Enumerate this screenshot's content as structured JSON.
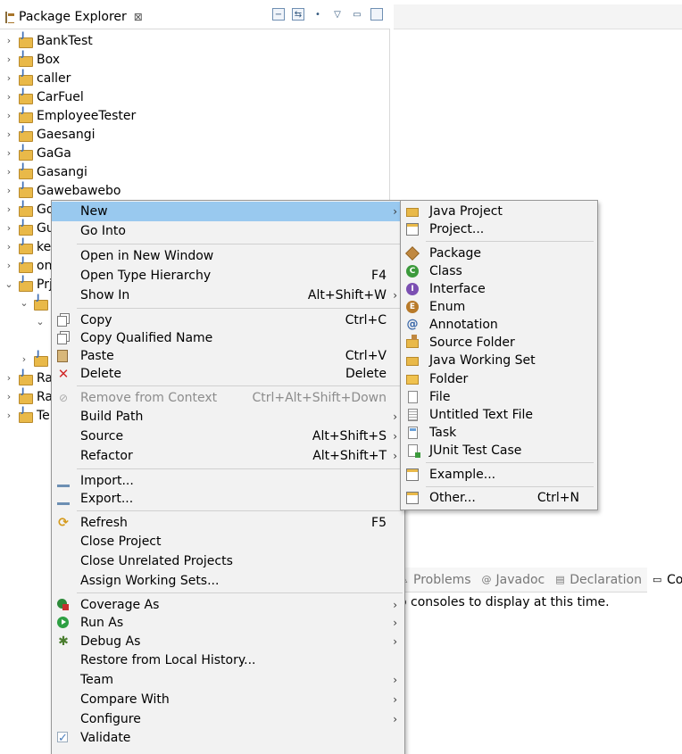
{
  "package_explorer": {
    "title": "Package Explorer",
    "close_glyph": "⊠",
    "projects": [
      {
        "label": "BankTest",
        "twisty": "›"
      },
      {
        "label": "Box",
        "twisty": "›"
      },
      {
        "label": "caller",
        "twisty": "›"
      },
      {
        "label": "CarFuel",
        "twisty": "›"
      },
      {
        "label": "EmployeeTester",
        "twisty": "›"
      },
      {
        "label": "Gaesangi",
        "twisty": "›"
      },
      {
        "label": "GaGa",
        "twisty": "›"
      },
      {
        "label": "Gasangi",
        "twisty": "›"
      },
      {
        "label": "Gawebawebo",
        "twisty": "›"
      },
      {
        "label": "Go",
        "twisty": "›"
      },
      {
        "label": "Gu",
        "twisty": "›"
      },
      {
        "label": "ke",
        "twisty": "›"
      },
      {
        "label": "on",
        "twisty": "›"
      },
      {
        "label": "Prj",
        "twisty": "⌄"
      },
      {
        "label": "",
        "twisty": "⌄"
      },
      {
        "label": "",
        "twisty": "⌄"
      },
      {
        "label": "",
        "twisty": "›"
      },
      {
        "label": "Ra",
        "twisty": "›"
      },
      {
        "label": "Ra",
        "twisty": "›"
      },
      {
        "label": "Te",
        "twisty": "›"
      }
    ]
  },
  "bottom_panel": {
    "tabs": [
      {
        "label": "Problems",
        "icon": "problems-icon"
      },
      {
        "label": "Javadoc",
        "icon": "javadoc-icon"
      },
      {
        "label": "Declaration",
        "icon": "declaration-icon"
      },
      {
        "label": "Conso",
        "icon": "console-icon"
      }
    ],
    "message": "o consoles to display at this time."
  },
  "context_menu": {
    "items": [
      {
        "label": "New",
        "accel": "",
        "arrow": "›",
        "icon": "",
        "selected": true
      },
      {
        "label": "Go Into",
        "accel": "",
        "arrow": "",
        "icon": ""
      },
      {
        "label": "Open in New Window",
        "accel": "",
        "arrow": "",
        "icon": ""
      },
      {
        "label": "Open Type Hierarchy",
        "accel": "F4",
        "arrow": "",
        "icon": ""
      },
      {
        "label": "Show In",
        "accel": "Alt+Shift+W",
        "arrow": "›",
        "icon": ""
      },
      {
        "label": "Copy",
        "accel": "Ctrl+C",
        "arrow": "",
        "icon": "copy-icon"
      },
      {
        "label": "Copy Qualified Name",
        "accel": "",
        "arrow": "",
        "icon": "copy-qualified-icon"
      },
      {
        "label": "Paste",
        "accel": "Ctrl+V",
        "arrow": "",
        "icon": "paste-icon"
      },
      {
        "label": "Delete",
        "accel": "Delete",
        "arrow": "",
        "icon": "delete-icon"
      },
      {
        "label": "Remove from Context",
        "accel": "Ctrl+Alt+Shift+Down",
        "arrow": "",
        "icon": "remove-context-icon",
        "disabled": true
      },
      {
        "label": "Build Path",
        "accel": "",
        "arrow": "›",
        "icon": ""
      },
      {
        "label": "Source",
        "accel": "Alt+Shift+S",
        "arrow": "›",
        "icon": ""
      },
      {
        "label": "Refactor",
        "accel": "Alt+Shift+T",
        "arrow": "›",
        "icon": ""
      },
      {
        "label": "Import...",
        "accel": "",
        "arrow": "",
        "icon": "import-icon"
      },
      {
        "label": "Export...",
        "accel": "",
        "arrow": "",
        "icon": "export-icon"
      },
      {
        "label": "Refresh",
        "accel": "F5",
        "arrow": "",
        "icon": "refresh-icon"
      },
      {
        "label": "Close Project",
        "accel": "",
        "arrow": "",
        "icon": ""
      },
      {
        "label": "Close Unrelated Projects",
        "accel": "",
        "arrow": "",
        "icon": ""
      },
      {
        "label": "Assign Working Sets...",
        "accel": "",
        "arrow": "",
        "icon": ""
      },
      {
        "label": "Coverage As",
        "accel": "",
        "arrow": "›",
        "icon": "coverage-icon"
      },
      {
        "label": "Run As",
        "accel": "",
        "arrow": "›",
        "icon": "run-icon"
      },
      {
        "label": "Debug As",
        "accel": "",
        "arrow": "›",
        "icon": "debug-icon"
      },
      {
        "label": "Restore from Local History...",
        "accel": "",
        "arrow": "",
        "icon": ""
      },
      {
        "label": "Team",
        "accel": "",
        "arrow": "›",
        "icon": ""
      },
      {
        "label": "Compare With",
        "accel": "",
        "arrow": "›",
        "icon": ""
      },
      {
        "label": "Configure",
        "accel": "",
        "arrow": "›",
        "icon": ""
      },
      {
        "label": "Validate",
        "accel": "",
        "arrow": "",
        "icon": "validate-check-icon"
      }
    ]
  },
  "new_submenu": {
    "items": [
      {
        "label": "Java Project",
        "accel": "",
        "icon": "java-project-icon"
      },
      {
        "label": "Project...",
        "accel": "",
        "icon": "project-icon"
      },
      {
        "label": "Package",
        "accel": "",
        "icon": "package-icon"
      },
      {
        "label": "Class",
        "accel": "",
        "icon": "class-icon"
      },
      {
        "label": "Interface",
        "accel": "",
        "icon": "interface-icon"
      },
      {
        "label": "Enum",
        "accel": "",
        "icon": "enum-icon"
      },
      {
        "label": "Annotation",
        "accel": "",
        "icon": "annotation-icon"
      },
      {
        "label": "Source Folder",
        "accel": "",
        "icon": "source-folder-icon"
      },
      {
        "label": "Java Working Set",
        "accel": "",
        "icon": "working-set-icon"
      },
      {
        "label": "Folder",
        "accel": "",
        "icon": "folder-icon"
      },
      {
        "label": "File",
        "accel": "",
        "icon": "file-icon"
      },
      {
        "label": "Untitled Text File",
        "accel": "",
        "icon": "text-file-icon"
      },
      {
        "label": "Task",
        "accel": "",
        "icon": "task-icon"
      },
      {
        "label": "JUnit Test Case",
        "accel": "",
        "icon": "junit-icon"
      },
      {
        "label": "Example...",
        "accel": "",
        "icon": "example-icon"
      },
      {
        "label": "Other...",
        "accel": "Ctrl+N",
        "icon": "other-icon"
      }
    ]
  },
  "colors": {
    "menu_bg": "#f2f2f2",
    "menu_selection": "#99c9ef",
    "disabled_text": "#8c8c8c"
  }
}
